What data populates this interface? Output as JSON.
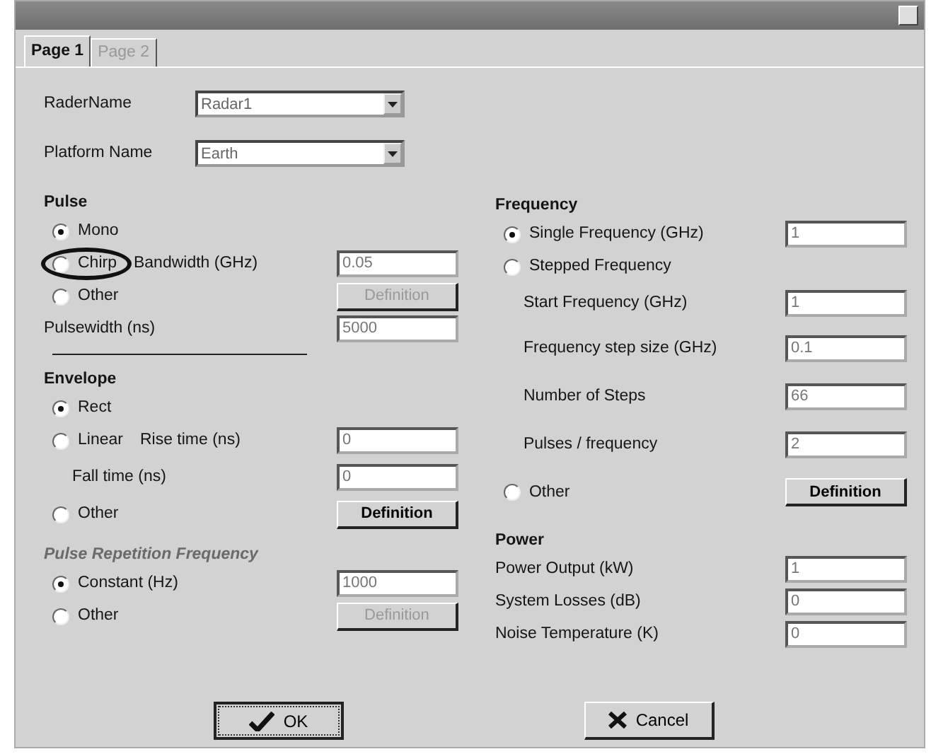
{
  "tabs": [
    {
      "label": "Page 1",
      "selected": true
    },
    {
      "label": "Page 2",
      "selected": false
    }
  ],
  "top_fields": [
    {
      "label": "RaderName",
      "value": "Radar1"
    },
    {
      "label": "Platform Name",
      "value": "Earth"
    }
  ],
  "left_sections": [
    {
      "title": "Pulse",
      "disabled": false,
      "rule_below": true,
      "rows": [
        {
          "kind": "radio",
          "label": "Mono",
          "checked": true
        },
        {
          "kind": "radio",
          "label": "Chirp",
          "checked": false,
          "circled": true,
          "field_label": "Bandwidth (GHz)",
          "value": "0.05"
        },
        {
          "kind": "radio",
          "label": "Other",
          "checked": false,
          "button": "Definition",
          "button_disabled": true
        },
        {
          "kind": "field",
          "label": "Pulsewidth (ns)",
          "value": "5000"
        }
      ]
    },
    {
      "title": "Envelope",
      "disabled": false,
      "rows": [
        {
          "kind": "radio",
          "label": "Rect",
          "checked": true
        },
        {
          "kind": "radio",
          "label": "Linear",
          "checked": false,
          "field_label": "Rise time (ns)",
          "value": "0"
        },
        {
          "kind": "subfield",
          "label": "Fall time (ns)",
          "value": "0"
        },
        {
          "kind": "radio",
          "label": "Other",
          "checked": false,
          "button": "Definition",
          "button_disabled": false
        }
      ]
    },
    {
      "title": "Pulse Repetition Frequency",
      "disabled": true,
      "rows": [
        {
          "kind": "radio",
          "label": "Constant (Hz)",
          "checked": true,
          "value": "1000"
        },
        {
          "kind": "radio",
          "label": "Other",
          "checked": false,
          "button": "Definition",
          "button_disabled": true
        }
      ]
    }
  ],
  "right_sections": [
    {
      "title": "Frequency",
      "disabled": false,
      "rows": [
        {
          "kind": "radio",
          "label": "Single Frequency (GHz)",
          "checked": true,
          "value": "1"
        },
        {
          "kind": "radio",
          "label": "Stepped Frequency",
          "checked": false
        },
        {
          "kind": "subfield",
          "label": "Start Frequency (GHz)",
          "value": "1"
        },
        {
          "kind": "subfield",
          "label": "Frequency step size (GHz)",
          "value": "0.1"
        },
        {
          "kind": "subfield",
          "label": "Number of Steps",
          "value": "66"
        },
        {
          "kind": "subfield",
          "label": "Pulses / frequency",
          "value": "2"
        },
        {
          "kind": "radio",
          "label": "Other",
          "checked": false,
          "button": "Definition",
          "button_disabled": false
        }
      ]
    },
    {
      "title": "Power",
      "disabled": false,
      "rows": [
        {
          "kind": "field",
          "label": "Power Output (kW)",
          "value": "1"
        },
        {
          "kind": "field",
          "label": "System Losses (dB)",
          "value": "0"
        },
        {
          "kind": "field",
          "label": "Noise Temperature (K)",
          "value": "0"
        }
      ]
    }
  ],
  "buttons": [
    {
      "kind": "ok",
      "label": "OK",
      "focused": true
    },
    {
      "kind": "cancel",
      "label": "Cancel",
      "focused": false
    }
  ]
}
